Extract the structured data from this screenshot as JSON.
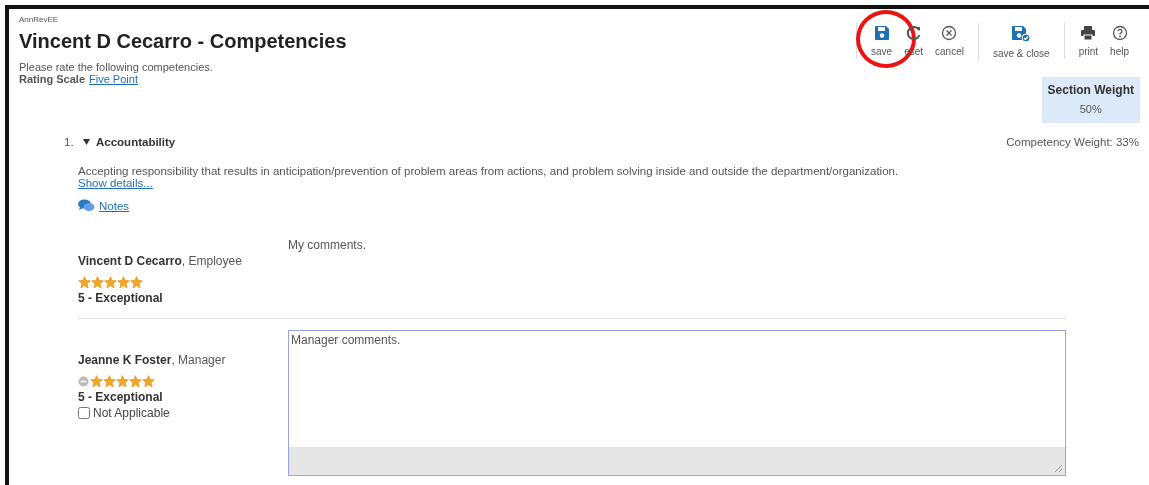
{
  "app_label": "AnnRevEE",
  "title": "Vincent D Cecarro - Competencies",
  "instructions": "Please rate the following competencies.",
  "rating_scale": {
    "label": "Rating Scale",
    "link": "Five Point"
  },
  "toolbar": [
    [
      {
        "label": "save",
        "highlighted": true
      },
      {
        "label": "eset",
        "highlighted": false
      },
      {
        "label": "cancel",
        "highlighted": false
      }
    ],
    [
      {
        "label": "save & close",
        "highlighted": false
      }
    ],
    [
      {
        "label": "print",
        "highlighted": false
      },
      {
        "label": "help",
        "highlighted": false
      }
    ]
  ],
  "section_weight": {
    "label": "Section Weight",
    "value": "50%"
  },
  "competency": {
    "number": "1.",
    "expanded": true,
    "name": "Accountability",
    "weight": "Competency Weight: 33%",
    "description": "Accepting responsibility that results in anticipation/prevention of problem areas from actions, and problem solving inside and outside the department/organization.",
    "details_link": "Show details...",
    "notes_link": "Notes",
    "ratings": [
      {
        "kind": "readonly",
        "name": "Vincent D Cecarro",
        "role": ", Employee",
        "stars": 5,
        "rating": "5 - Exceptional",
        "comment": "My comments."
      },
      {
        "kind": "editable",
        "name": "Jeanne K Foster",
        "role": ", Manager",
        "stars": 5,
        "rating": "5 - Exceptional",
        "not_applicable": {
          "label": "Not Applicable",
          "checked": false
        },
        "comment": "Manager comments."
      }
    ]
  }
}
